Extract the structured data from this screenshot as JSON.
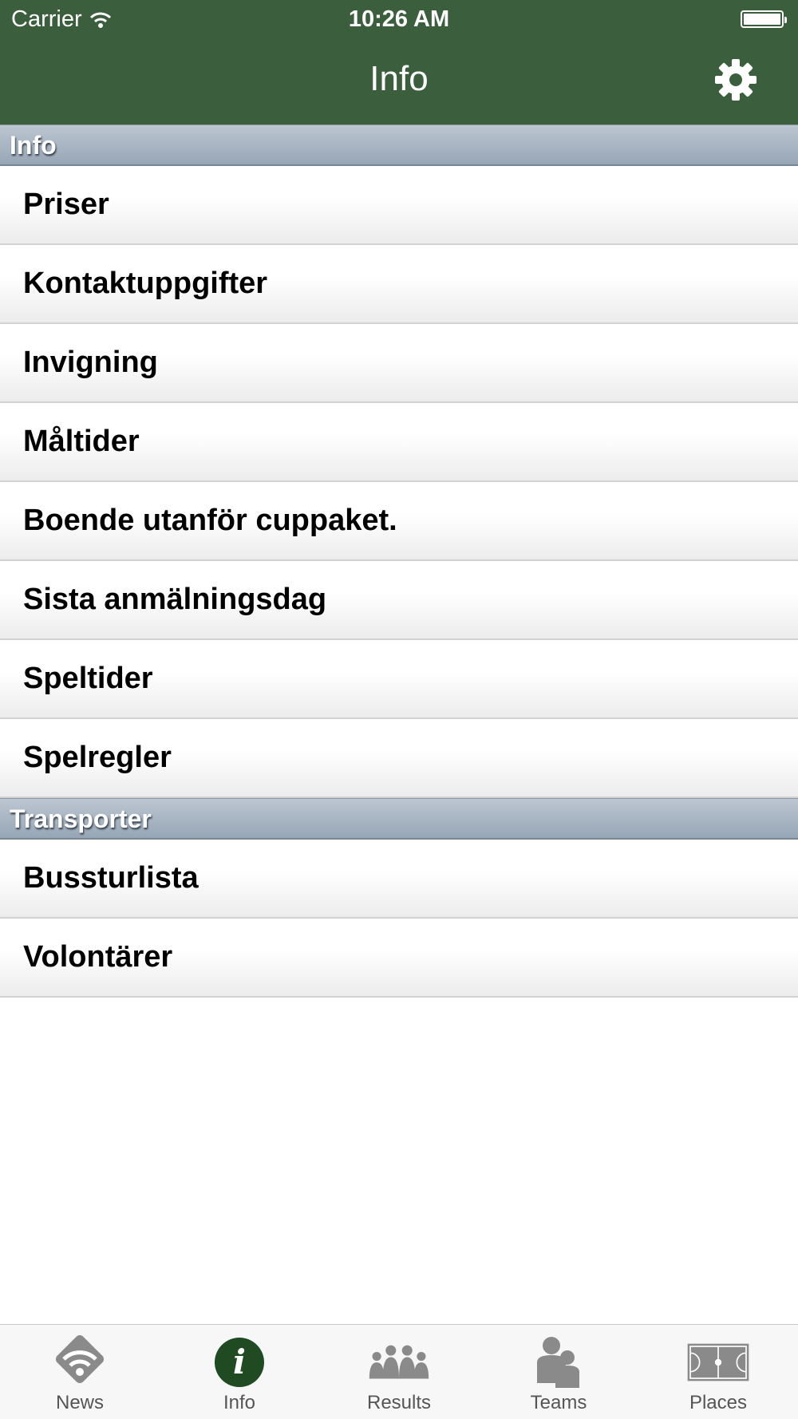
{
  "status_bar": {
    "carrier": "Carrier",
    "time": "10:26 AM"
  },
  "nav": {
    "title": "Info",
    "settings_icon": "gear-icon"
  },
  "sections": [
    {
      "header": "Info",
      "items": [
        "Priser",
        "Kontaktuppgifter",
        "Invigning",
        "Måltider",
        "Boende utanför cuppaket.",
        "Sista anmälningsdag",
        "Speltider",
        "Spelregler"
      ]
    },
    {
      "header": "Transporter",
      "items": [
        "Bussturlista",
        "Volontärer"
      ]
    }
  ],
  "tabbar": {
    "active": "Info",
    "tabs": [
      {
        "label": "News",
        "icon": "news-icon"
      },
      {
        "label": "Info",
        "icon": "info-icon"
      },
      {
        "label": "Results",
        "icon": "results-icon"
      },
      {
        "label": "Teams",
        "icon": "teams-icon"
      },
      {
        "label": "Places",
        "icon": "places-icon"
      }
    ]
  },
  "colors": {
    "nav_bg": "#3b5e3c",
    "section_header": "#a5b2c0",
    "active_tab": "#1f4a22",
    "inactive_tab": "#8a8a8a"
  }
}
